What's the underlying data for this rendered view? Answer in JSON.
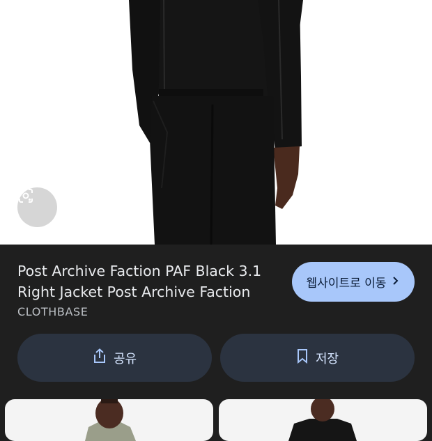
{
  "product": {
    "title": "Post Archive Faction PAF Black 3.1 Right Jacket Post Archive Faction",
    "source": "CLOTHBASE"
  },
  "actions": {
    "visit_label": "웹사이트로 이동",
    "share_label": "공유",
    "save_label": "저장"
  },
  "icons": {
    "lens": "lens-search-icon",
    "chevron": "chevron-right-icon",
    "share": "share-icon",
    "bookmark": "bookmark-icon"
  },
  "colors": {
    "panel_bg": "#1f1f1f",
    "visit_button_bg": "#a8c7fa",
    "action_button_bg": "#2b3340",
    "action_text": "#d3e3fd",
    "title_text": "#e8eaed"
  }
}
